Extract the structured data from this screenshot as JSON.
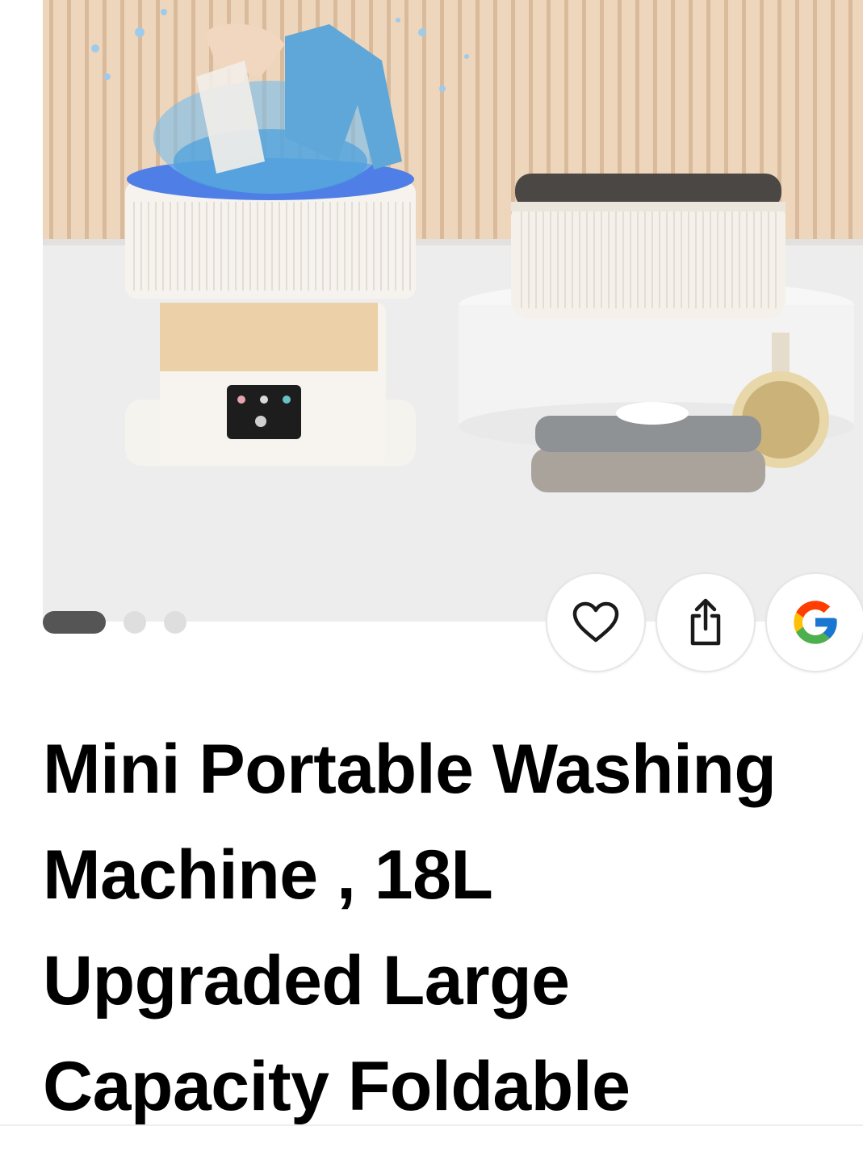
{
  "product": {
    "title_lines": [
      "Mini Portable Washing",
      "Machine , 18L",
      "Upgraded Large",
      "Capacity Foldable"
    ]
  },
  "carousel": {
    "image_count": 3,
    "active_index": 0
  },
  "actions": {
    "favorite_icon": "heart-icon",
    "share_icon": "share-icon",
    "google_icon": "google-logo-icon"
  },
  "colors": {
    "title": "#000000",
    "dot_active": "#555555",
    "dot_inactive": "#dedede",
    "google_blue": "#4285F4",
    "google_red": "#EA4335",
    "google_yellow": "#FBBC05",
    "google_green": "#34A853"
  }
}
